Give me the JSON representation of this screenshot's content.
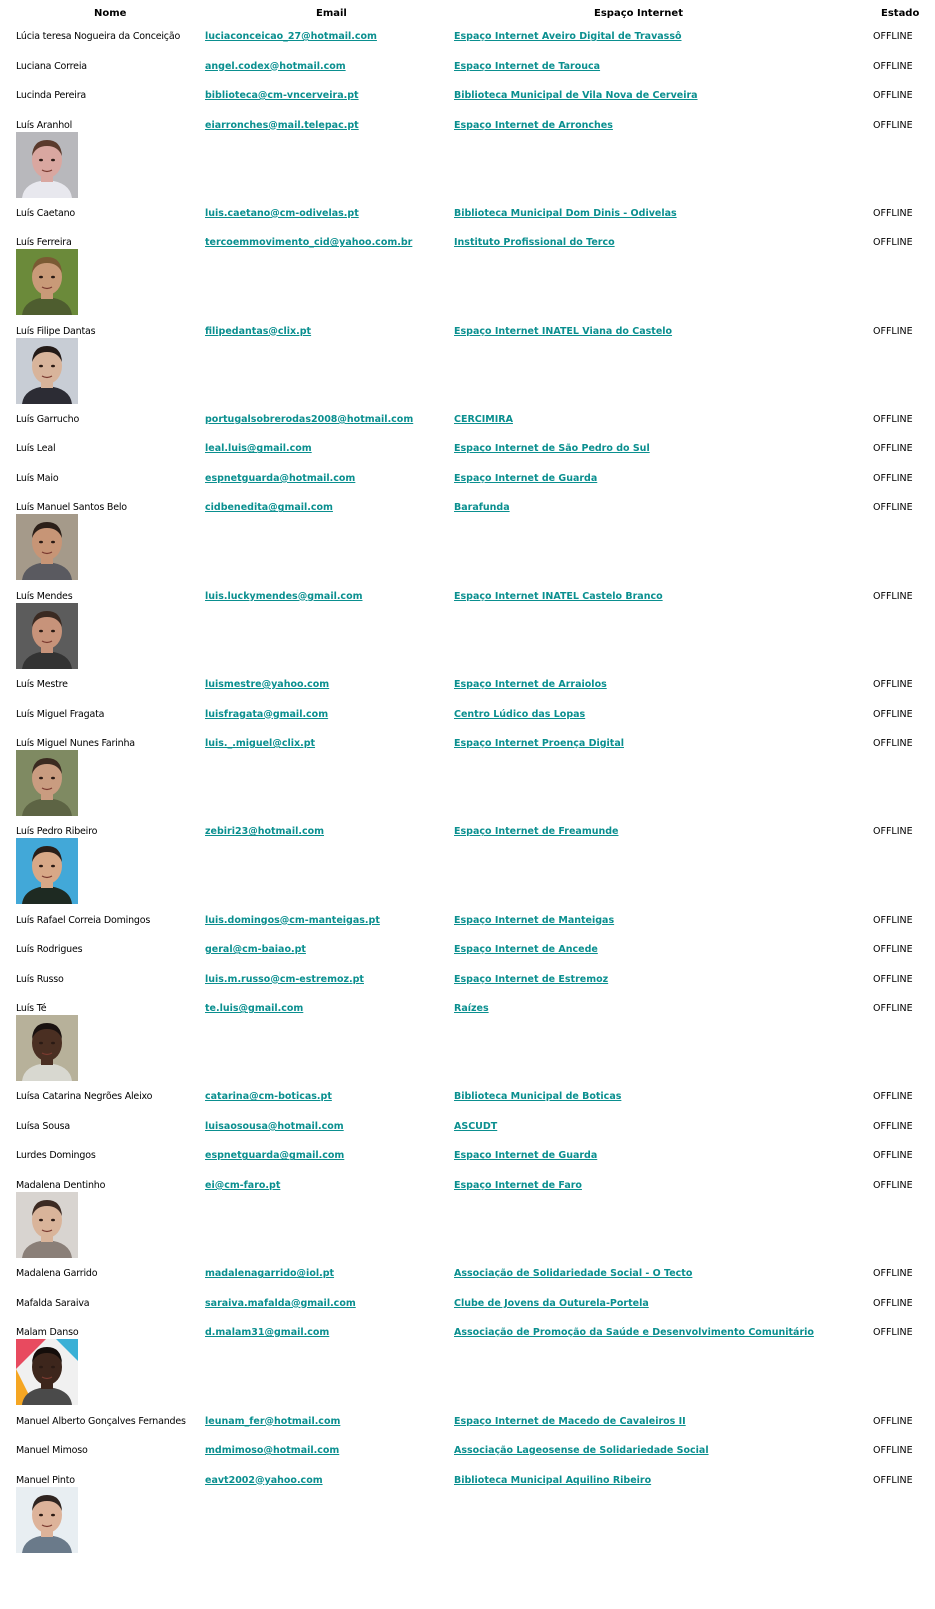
{
  "headers": {
    "nome": "Nome",
    "email": "Email",
    "espaco": "Espaço Internet",
    "estado": "Estado"
  },
  "rows": [
    {
      "name": "Lúcia teresa Nogueira da Conceição",
      "email": "luciaconceicao_27@hotmail.com",
      "espaco": "Espaço Internet Aveiro Digital de Travassô",
      "estado": "OFFLINE",
      "photo": false
    },
    {
      "name": "Luciana Correia",
      "email": "angel.codex@hotmail.com",
      "espaco": "Espaço Internet de Tarouca",
      "estado": "OFFLINE",
      "photo": false
    },
    {
      "name": "Lucinda Pereira",
      "email": "biblioteca@cm-vncerveira.pt",
      "espaco": "Biblioteca Municipal de Vila Nova de Cerveira",
      "estado": "OFFLINE",
      "photo": false
    },
    {
      "name": "Luís Aranhol",
      "email": "eiarronches@mail.telepac.pt",
      "espaco": "Espaço Internet de Arronches",
      "estado": "OFFLINE",
      "photo": true
    },
    {
      "name": "Luís Caetano",
      "email": "luis.caetano@cm-odivelas.pt",
      "espaco": "Biblioteca Municipal Dom Dinis - Odivelas",
      "estado": "OFFLINE",
      "photo": false
    },
    {
      "name": "Luís Ferreira",
      "email": "tercoemmovimento_cid@yahoo.com.br",
      "espaco": "Instituto Profissional do Terco",
      "estado": "OFFLINE",
      "photo": true
    },
    {
      "name": "Luís Filipe Dantas",
      "email": "filipedantas@clix.pt",
      "espaco": "Espaço Internet INATEL Viana do Castelo",
      "estado": "OFFLINE",
      "photo": true
    },
    {
      "name": "Luís Garrucho",
      "email": "portugalsobrerodas2008@hotmail.com",
      "espaco": "CERCIMIRA",
      "estado": "OFFLINE",
      "photo": false
    },
    {
      "name": "Luís Leal",
      "email": "leal.luis@gmail.com",
      "espaco": "Espaço Internet de São Pedro do Sul",
      "estado": "OFFLINE",
      "photo": false
    },
    {
      "name": "Luís Maio",
      "email": "espnetguarda@hotmail.com",
      "espaco": "Espaço Internet de Guarda",
      "estado": "OFFLINE",
      "photo": false
    },
    {
      "name": "Luís Manuel Santos Belo",
      "email": "cidbenedita@gmail.com",
      "espaco": "Barafunda",
      "estado": "OFFLINE",
      "photo": true
    },
    {
      "name": "Luís Mendes",
      "email": "luis.luckymendes@gmail.com",
      "espaco": "Espaço Internet INATEL Castelo Branco",
      "estado": "OFFLINE",
      "photo": true
    },
    {
      "name": "Luís Mestre",
      "email": "luismestre@yahoo.com",
      "espaco": "Espaço Internet de Arraiolos",
      "estado": "OFFLINE",
      "photo": false
    },
    {
      "name": "Luís Miguel Fragata",
      "email": "luisfragata@gmail.com",
      "espaco": "Centro Lúdico das Lopas",
      "estado": "OFFLINE",
      "photo": false
    },
    {
      "name": "Luís Miguel Nunes Farinha",
      "email": "luis._.miguel@clix.pt",
      "espaco": "Espaço Internet Proença Digital",
      "estado": "OFFLINE",
      "photo": true
    },
    {
      "name": "Luís Pedro Ribeiro",
      "email": "zebiri23@hotmail.com",
      "espaco": "Espaço Internet de Freamunde",
      "estado": "OFFLINE",
      "photo": true
    },
    {
      "name": "Luís Rafael Correia Domingos",
      "email": "luis.domingos@cm-manteigas.pt",
      "espaco": "Espaço Internet de Manteigas",
      "estado": "OFFLINE",
      "photo": false
    },
    {
      "name": "Luís Rodrigues",
      "email": "geral@cm-baiao.pt",
      "espaco": "Espaço Internet de Ancede",
      "estado": "OFFLINE",
      "photo": false
    },
    {
      "name": "Luís Russo",
      "email": "luis.m.russo@cm-estremoz.pt",
      "espaco": "Espaço Internet de Estremoz",
      "estado": "OFFLINE",
      "photo": false
    },
    {
      "name": "Luís Té",
      "email": "te.luis@gmail.com",
      "espaco": "Raízes",
      "estado": "OFFLINE",
      "photo": true
    },
    {
      "name": "Luísa Catarina Negrões Aleixo",
      "email": "catarina@cm-boticas.pt",
      "espaco": "Biblioteca Municipal de Boticas",
      "estado": "OFFLINE",
      "photo": false
    },
    {
      "name": "Luísa Sousa",
      "email": "luisaosousa@hotmail.com",
      "espaco": "ASCUDT",
      "estado": "OFFLINE",
      "photo": false
    },
    {
      "name": "Lurdes Domingos",
      "email": "espnetguarda@gmail.com",
      "espaco": "Espaço Internet de Guarda",
      "estado": "OFFLINE",
      "photo": false
    },
    {
      "name": "Madalena Dentinho",
      "email": "ei@cm-faro.pt",
      "espaco": "Espaço Internet de Faro",
      "estado": "OFFLINE",
      "photo": true
    },
    {
      "name": "Madalena Garrido",
      "email": "madalenagarrido@iol.pt",
      "espaco": "Associação de Solidariedade Social - O Tecto",
      "estado": "OFFLINE",
      "photo": false
    },
    {
      "name": "Mafalda Saraiva",
      "email": "saraiva.mafalda@gmail.com",
      "espaco": "Clube de Jovens da Outurela-Portela",
      "estado": "OFFLINE",
      "photo": false
    },
    {
      "name": "Malam Danso",
      "email": "d.malam31@gmail.com",
      "espaco": "Associação de Promoção da Saúde e Desenvolvimento Comunitário",
      "estado": "OFFLINE",
      "photo": true
    },
    {
      "name": "Manuel Alberto Gonçalves Fernandes",
      "email": "leunam_fer@hotmail.com",
      "espaco": "Espaço Internet de Macedo de Cavaleiros II",
      "estado": "OFFLINE",
      "photo": false
    },
    {
      "name": "Manuel Mimoso",
      "email": "mdmimoso@hotmail.com",
      "espaco": "Associação Lageosense de Solidariedade Social",
      "estado": "OFFLINE",
      "photo": false
    },
    {
      "name": "Manuel Pinto",
      "email": "eavt2002@yahoo.com",
      "espaco": "Biblioteca Municipal Aquilino Ribeiro",
      "estado": "OFFLINE",
      "photo": true
    }
  ],
  "colors": {
    "link": "#0a8f8f",
    "text": "#000000"
  }
}
